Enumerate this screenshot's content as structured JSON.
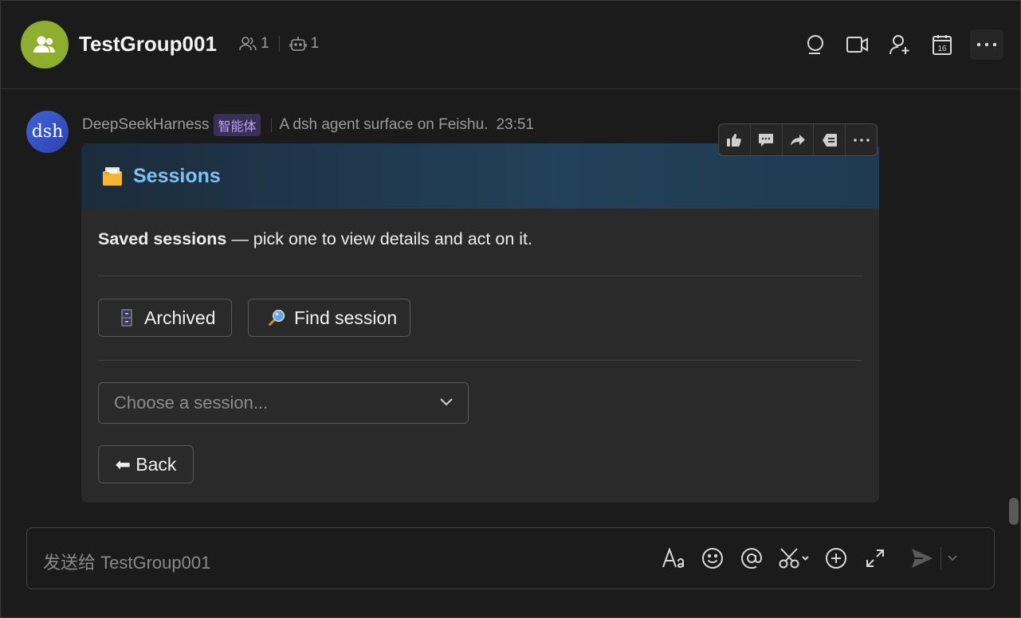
{
  "header": {
    "title": "TestGroup001",
    "member_count": "1",
    "bot_count": "1",
    "icons": [
      "search-icon",
      "video-call-icon",
      "add-member-icon",
      "calendar-icon",
      "more-icon"
    ],
    "calendar_day": "16"
  },
  "message": {
    "avatar_text": "dsh",
    "sender": "DeepSeekHarness",
    "badge": "智能体",
    "description": "A dsh agent surface on Feishu.",
    "time": "23:51"
  },
  "card": {
    "emoji": "card-index-dividers-icon",
    "title": "Sessions",
    "desc_bold": "Saved sessions",
    "desc_rest": " — pick one to view details and act on it.",
    "buttons": [
      {
        "icon": "file-cabinet-icon",
        "label": "Archived"
      },
      {
        "icon": "magnifier-icon",
        "label": "Find session"
      }
    ],
    "select_placeholder": "Choose a session...",
    "back_label": "⬅ Back"
  },
  "hover_actions": [
    "thumbs-up-icon",
    "reply-icon",
    "forward-icon",
    "quote-icon",
    "more-icon"
  ],
  "composer": {
    "placeholder": "发送给 TestGroup001",
    "icons": [
      "text-format-icon",
      "emoji-icon",
      "mention-icon",
      "screenshot-icon",
      "add-icon",
      "expand-icon",
      "send-icon"
    ]
  },
  "colors": {
    "group_avatar": "#8fae2f",
    "card_title": "#7cc2f5",
    "badge_bg": "#3a2f57"
  }
}
